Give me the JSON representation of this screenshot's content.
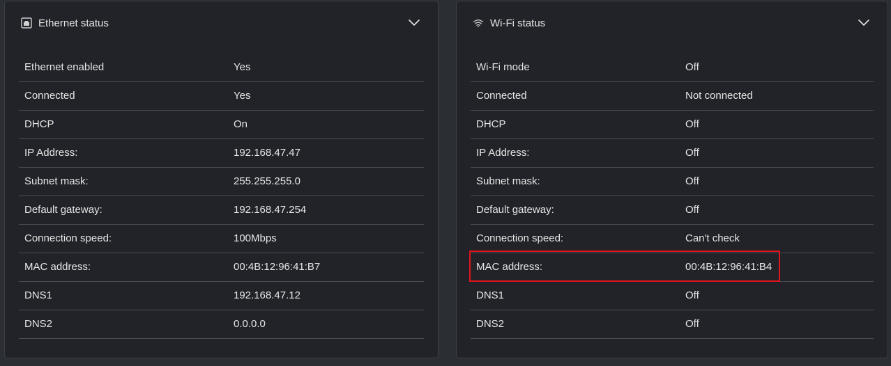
{
  "ethernet": {
    "title": "Ethernet status",
    "icon": "ethernet-port-icon",
    "rows": [
      {
        "label": "Ethernet enabled",
        "value": "Yes"
      },
      {
        "label": "Connected",
        "value": "Yes"
      },
      {
        "label": "DHCP",
        "value": "On"
      },
      {
        "label": "IP Address:",
        "value": "192.168.47.47"
      },
      {
        "label": "Subnet mask:",
        "value": "255.255.255.0"
      },
      {
        "label": "Default gateway:",
        "value": "192.168.47.254"
      },
      {
        "label": "Connection speed:",
        "value": "100Mbps"
      },
      {
        "label": "MAC address:",
        "value": "00:4B:12:96:41:B7"
      },
      {
        "label": "DNS1",
        "value": "192.168.47.12"
      },
      {
        "label": "DNS2",
        "value": "0.0.0.0"
      }
    ]
  },
  "wifi": {
    "title": "Wi-Fi status",
    "icon": "wifi-icon",
    "rows": [
      {
        "label": "Wi-Fi mode",
        "value": "Off"
      },
      {
        "label": "Connected",
        "value": "Not connected"
      },
      {
        "label": "DHCP",
        "value": "Off"
      },
      {
        "label": "IP Address:",
        "value": "Off"
      },
      {
        "label": "Subnet mask:",
        "value": "Off"
      },
      {
        "label": "Default gateway:",
        "value": "Off"
      },
      {
        "label": "Connection speed:",
        "value": "Can't check"
      },
      {
        "label": "MAC address:",
        "value": "00:4B:12:96:41:B4"
      },
      {
        "label": "DNS1",
        "value": "Off"
      },
      {
        "label": "DNS2",
        "value": "Off"
      }
    ]
  },
  "colors": {
    "background": "#2b2e33",
    "panel": "#212328",
    "text": "#e6e6e6",
    "divider": "#4a4d52",
    "highlight": "#e0141b"
  }
}
